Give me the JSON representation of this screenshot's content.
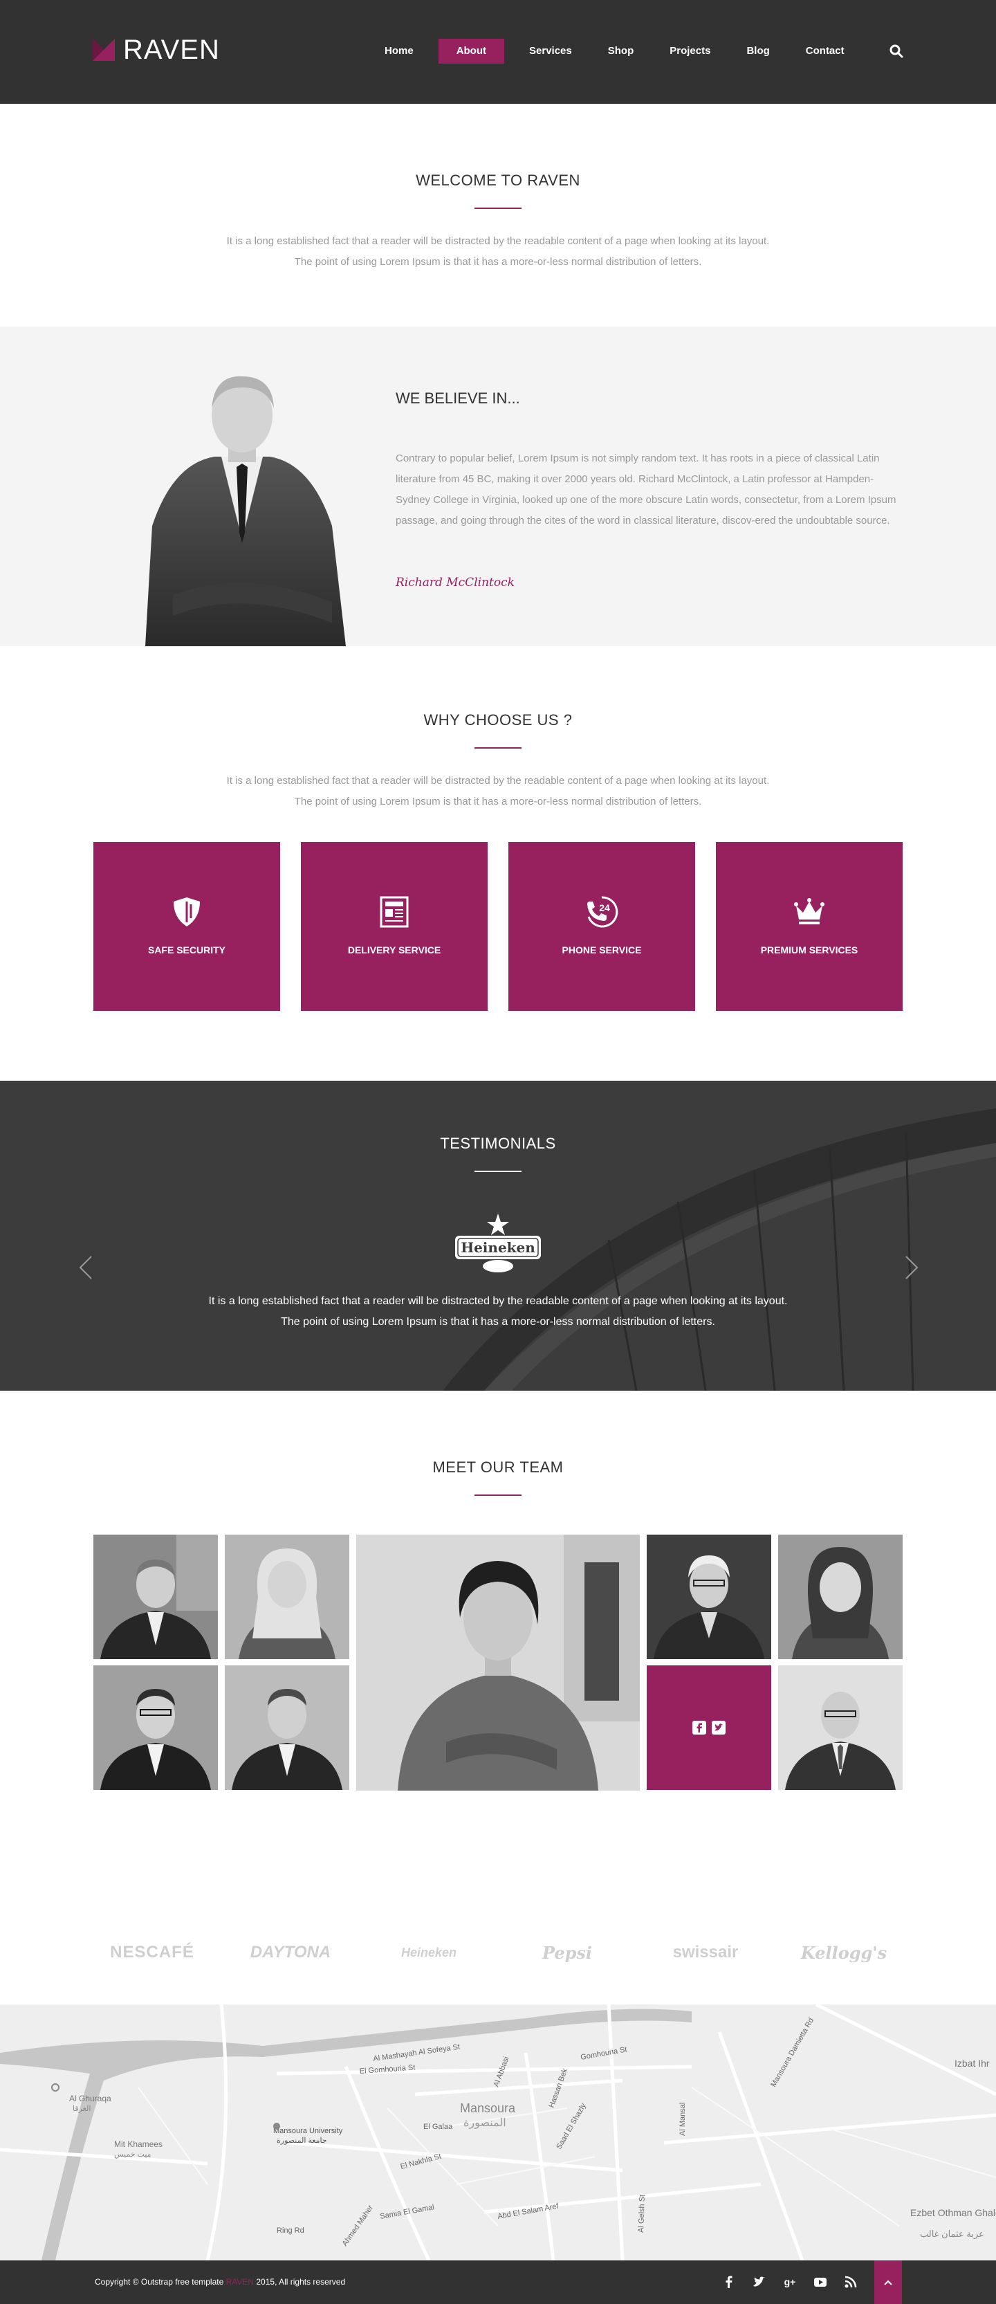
{
  "header": {
    "logo": "RAVEN",
    "nav": [
      "Home",
      "About",
      "Services",
      "Shop",
      "Projects",
      "Blog",
      "Contact"
    ],
    "active_nav": "About"
  },
  "welcome": {
    "title": "WELCOME TO RAVEN",
    "line1": "It is a long established fact that a reader will be distracted by the readable content of a page when looking at its layout.",
    "line2": "The point of using Lorem Ipsum is that it has a more-or-less normal distribution of letters."
  },
  "believe": {
    "title": "WE BELIEVE IN...",
    "text": "Contrary to popular belief, Lorem Ipsum is not simply random text. It has roots in a piece of classical Latin literature from 45 BC, making it over 2000 years old. Richard McClintock, a Latin professor at Hampden-Sydney College in Virginia, looked up one of the more obscure Latin words, consectetur, from a Lorem Ipsum passage, and going through the cites of the word in classical literature, discov-ered the undoubtable source.",
    "signature": "Richard McClintock"
  },
  "why": {
    "title": "WHY CHOOSE US ?",
    "line1": "It is a long established fact that a reader will be distracted by the readable content of a page when looking at its layout.",
    "line2": "The point of using Lorem Ipsum is that it has a more-or-less normal distribution of letters.",
    "features": [
      {
        "label": "SAFE SECURITY",
        "icon": "shield-icon"
      },
      {
        "label": "DELIVERY SERVICE",
        "icon": "newspaper-icon"
      },
      {
        "label": "PHONE SERVICE",
        "icon": "phone-24-icon",
        "badge": "24"
      },
      {
        "label": "PREMIUM SERVICES",
        "icon": "crown-icon"
      }
    ]
  },
  "testimonials": {
    "title": "TESTIMONIALS",
    "brand": "Heineken",
    "line1": "It is a long established fact that a reader will be distracted by the readable content of a page when looking at its layout.",
    "line2": "The point of using Lorem Ipsum is that it has a more-or-less normal distribution of letters."
  },
  "team": {
    "title": "MEET OUR TEAM"
  },
  "brands": [
    "NESCAFÉ",
    "DAYTONA",
    "Heineken",
    "Pepsi",
    "swissair",
    "Kellogg's"
  ],
  "map": {
    "labels": [
      "Mansoura",
      "المنصورة",
      "Mansoura University",
      "جامعة المنصورة",
      "Mit Khamees",
      "ميت خميس",
      "Al Ghuraqa",
      "الغرقا",
      "El Gomhouria St",
      "Al Mashayah Al Sofeya St",
      "El Galaa",
      "El Nakhla St",
      "Ring Rd",
      "Al Abbasi",
      "Hassan Bek",
      "Saad El Shazly",
      "Abd El Salam Aref",
      "Al Mansal",
      "Samia El Gamal",
      "Ahmed Maher",
      "Gomhouria St",
      "Izbat Ihr",
      "Ezbet Othman Ghaleb",
      "عزبة عثمان غالب",
      "Mansoura Damietta Rd",
      "Al Gelsh St"
    ]
  },
  "footer": {
    "copyright_prefix": "Copyright © Outstrap free template ",
    "copyright_brand": "RAVEN",
    "copyright_suffix": " 2015, All rights reserved",
    "social": [
      "f",
      "t",
      "g+",
      "yt",
      "rss"
    ]
  },
  "colors": {
    "accent": "#97215f",
    "dark": "#323232"
  }
}
